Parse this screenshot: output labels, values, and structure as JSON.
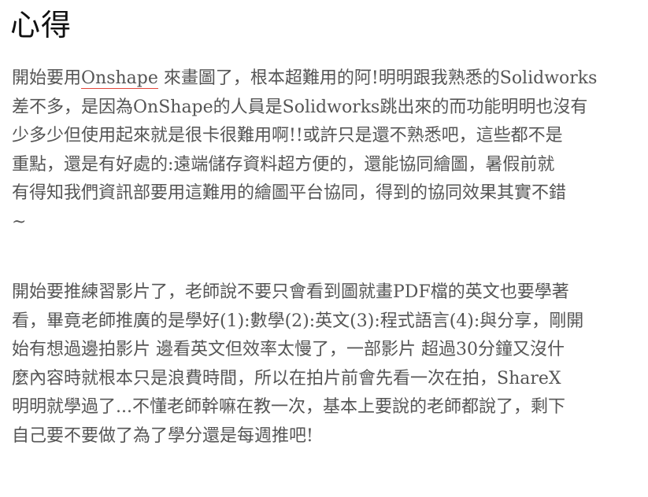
{
  "article": {
    "title": "心得",
    "paragraph1": {
      "line1_before_link": "開始要用",
      "line1_link": "Onshape",
      "line1_after_link": " 來畫圖了，根本超難用的阿!明明跟我熟悉的Solidworks",
      "lines": [
        "差不多，是因為OnShape的人員是Solidworks跳出來的而功能明明也沒有",
        "少多少但使用起來就是很卡很難用啊!!或許只是還不熟悉吧，這些都不是",
        "重點，還是有好處的:遠端儲存資料超方便的，還能協同繪圖，暑假前就",
        "有得知我們資訊部要用這難用的繪圖平台協同，得到的協同效果其實不錯",
        "~"
      ]
    },
    "paragraph2": {
      "lines": [
        "開始要推練習影片了，老師說不要只會看到圖就畫PDF檔的英文也要學著",
        "看，畢竟老師推廣的是學好(1):數學(2):英文(3):程式語言(4):與分享，剛開",
        "始有想過邊拍影片 邊看英文但效率太慢了，一部影片 超過30分鐘又沒什",
        "麼內容時就根本只是浪費時間，所以在拍片前會先看一次在拍，ShareX",
        "明明就學過了...不懂老師幹嘛在教一次，基本上要說的老師都說了，剩下",
        "自己要不要做了為了學分還是每週推吧!"
      ]
    }
  },
  "colors": {
    "text": "#555555",
    "title": "#111111",
    "link_underline": "#e2463b",
    "background": "#ffffff"
  }
}
